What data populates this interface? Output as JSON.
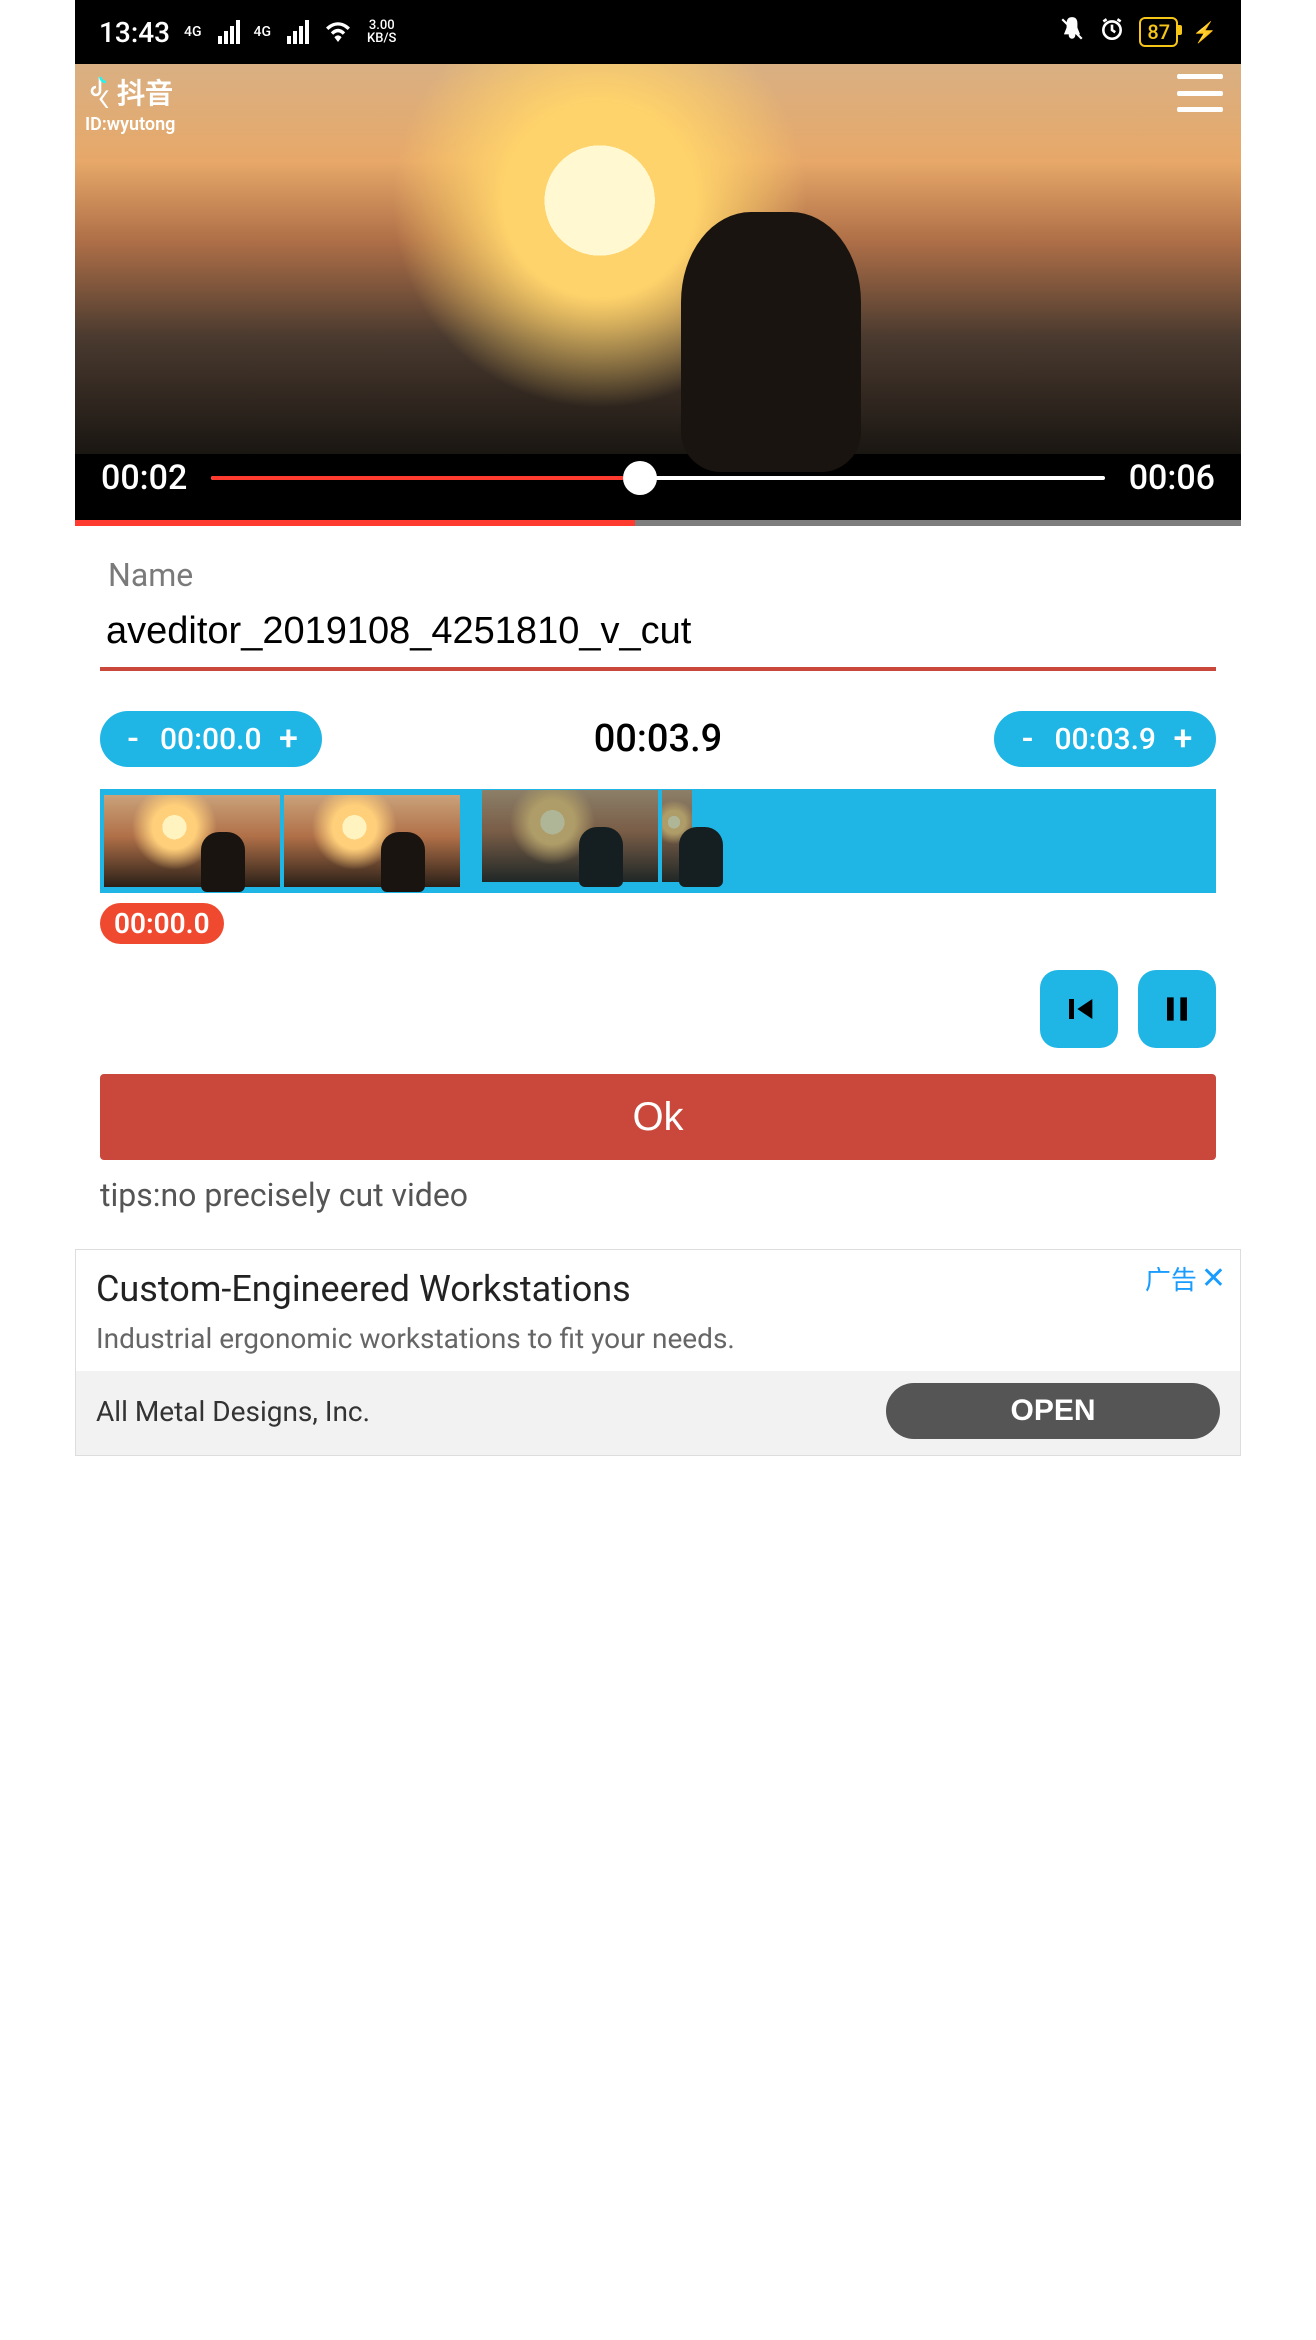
{
  "statusbar": {
    "time": "13:43",
    "net_label": "4G",
    "speed_value": "3.00",
    "speed_unit": "KB/S",
    "battery": "87"
  },
  "video": {
    "watermark_app": "抖音",
    "watermark_id": "ID:wyutong",
    "current_time": "00:02",
    "total_time": "00:06",
    "progress_percent": 48
  },
  "form": {
    "name_label": "Name",
    "name_value": "aveditor_2019108_4251810_v_cut",
    "start_time": "00:00.0",
    "center_time": "00:03.9",
    "end_time": "00:03.9",
    "minus": "-",
    "plus": "+",
    "position_badge": "00:00.0",
    "ok_label": "Ok",
    "tips": "tips:no precisely cut video"
  },
  "ad": {
    "tag": "广告",
    "title": "Custom-Engineered Workstations",
    "subtitle": "Industrial ergonomic workstations to fit your needs.",
    "company": "All Metal Designs, Inc.",
    "open_label": "OPEN"
  }
}
